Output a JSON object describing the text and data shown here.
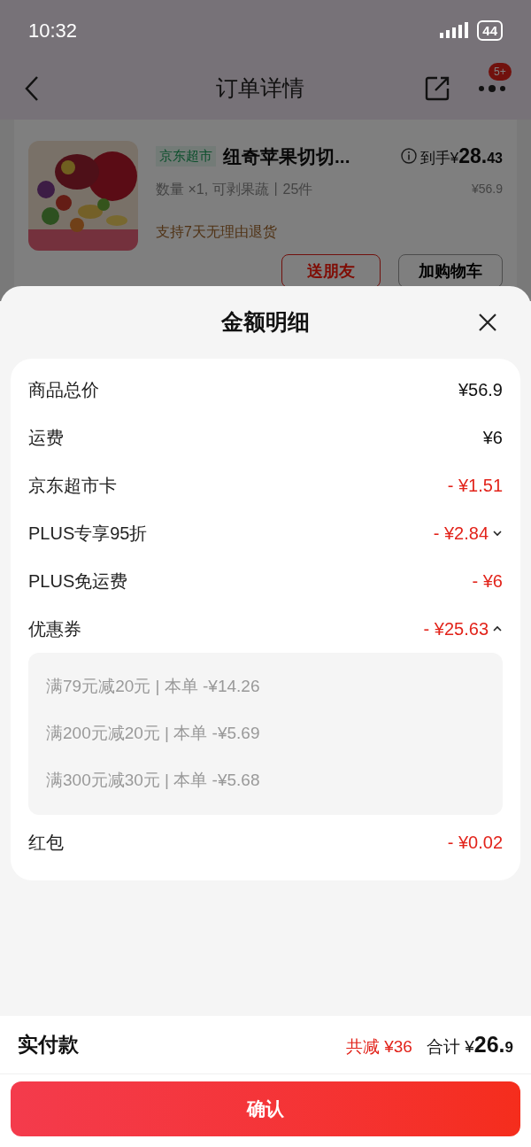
{
  "status_bar": {
    "time": "10:32",
    "battery": "44"
  },
  "header": {
    "title": "订单详情",
    "badge": "5+"
  },
  "product": {
    "store_tag": "京东超市",
    "name": "纽奇苹果切切...",
    "final_label": "到手",
    "final_currency": "¥",
    "final_int": "28.",
    "final_dec": "43",
    "spec": "数量 ×1, 可剥果蔬丨25件",
    "original_price": "¥56.9",
    "return_policy": "支持7天无理由退货",
    "buttons": [
      "送朋友",
      "加购物车"
    ]
  },
  "sheet": {
    "title": "金额明细",
    "rows": [
      {
        "label": "商品总价",
        "value": "¥56.9",
        "kind": "plain"
      },
      {
        "label": "运费",
        "value": "¥6",
        "kind": "plain"
      },
      {
        "label": "京东超市卡",
        "value": "- ¥1.51",
        "kind": "discount"
      },
      {
        "label": "PLUS专享95折",
        "value": "- ¥2.84",
        "kind": "discount",
        "expanded": false
      },
      {
        "label": "PLUS免运费",
        "value": "- ¥6",
        "kind": "discount"
      },
      {
        "label": "优惠券",
        "value": "- ¥25.63",
        "kind": "discount",
        "expanded": true,
        "details": [
          "满79元减20元 | 本单 -¥14.26",
          "满200元减20元 | 本单 -¥5.69",
          "满300元减30元 | 本单 -¥5.68"
        ]
      },
      {
        "label": "红包",
        "value": "- ¥0.02",
        "kind": "discount"
      }
    ]
  },
  "footer": {
    "label": "实付款",
    "saved": "共减 ¥36",
    "total_label": "合计",
    "total_currency": "¥",
    "total_int": "26.",
    "total_dec": "9",
    "confirm": "确认"
  }
}
